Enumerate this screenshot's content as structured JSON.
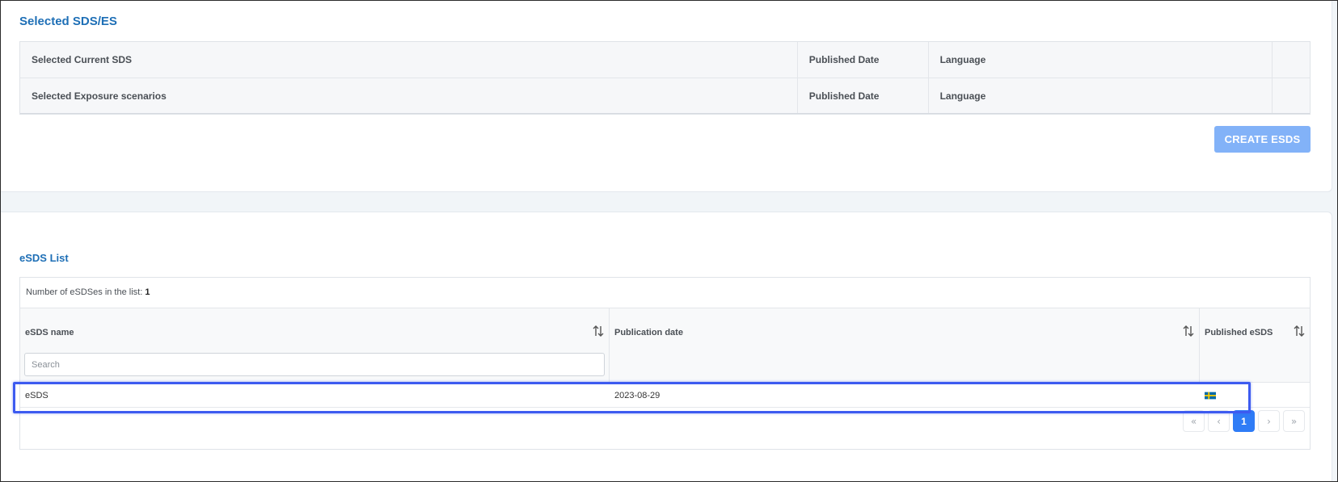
{
  "selected_section": {
    "title": "Selected SDS/ES",
    "rows": [
      {
        "label": "Selected Current SDS",
        "date_header": "Published Date",
        "language_header": "Language"
      },
      {
        "label": "Selected Exposure scenarios",
        "date_header": "Published Date",
        "language_header": "Language"
      }
    ],
    "create_button": "CREATE ESDS"
  },
  "esds_list": {
    "title": "eSDS List",
    "count_label": "Number of eSDSes in the list:",
    "count_value": "1",
    "columns": [
      "eSDS name",
      "Publication date",
      "Published eSDS"
    ],
    "search_placeholder": "Search",
    "rows": [
      {
        "name": "eSDS",
        "publication_date": "2023-08-29",
        "flag": "sweden-flag-icon"
      }
    ],
    "pagination": {
      "first": "«",
      "prev": "‹",
      "current": "1",
      "next": "›",
      "last": "»"
    }
  },
  "colors": {
    "title_blue": "#1e6fb6",
    "button_disabled": "#82b2f8",
    "page_active": "#2f7cf6",
    "highlight": "#3d5bf0"
  }
}
